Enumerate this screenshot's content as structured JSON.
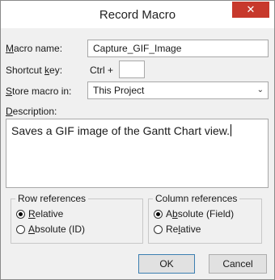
{
  "window": {
    "title": "Record Macro",
    "close_glyph": "✕"
  },
  "form": {
    "macro_name": {
      "label_pre": "",
      "label_u": "M",
      "label_post": "acro name:",
      "value": "Capture_GIF_Image"
    },
    "shortcut": {
      "label_pre": "Shortcut ",
      "label_u": "k",
      "label_post": "ey:",
      "prefix": "Ctrl +",
      "value": ""
    },
    "store_in": {
      "label_pre": "",
      "label_u": "S",
      "label_post": "tore macro in:",
      "value": "This Project",
      "arrow": "⌄"
    },
    "description": {
      "label_pre": "",
      "label_u": "D",
      "label_post": "escription:",
      "value": "Saves a GIF image of the Gantt Chart view."
    }
  },
  "row_refs": {
    "title": "Row references",
    "options": [
      {
        "pre": "",
        "u": "R",
        "post": "elative",
        "selected": true
      },
      {
        "pre": "",
        "u": "A",
        "post": "bsolute (ID)",
        "selected": false
      }
    ]
  },
  "col_refs": {
    "title": "Column references",
    "options": [
      {
        "pre": "A",
        "u": "b",
        "post": "solute (Field)",
        "selected": true
      },
      {
        "pre": "Re",
        "u": "l",
        "post": "ative",
        "selected": false
      }
    ]
  },
  "buttons": {
    "ok": "OK",
    "cancel": "Cancel"
  }
}
